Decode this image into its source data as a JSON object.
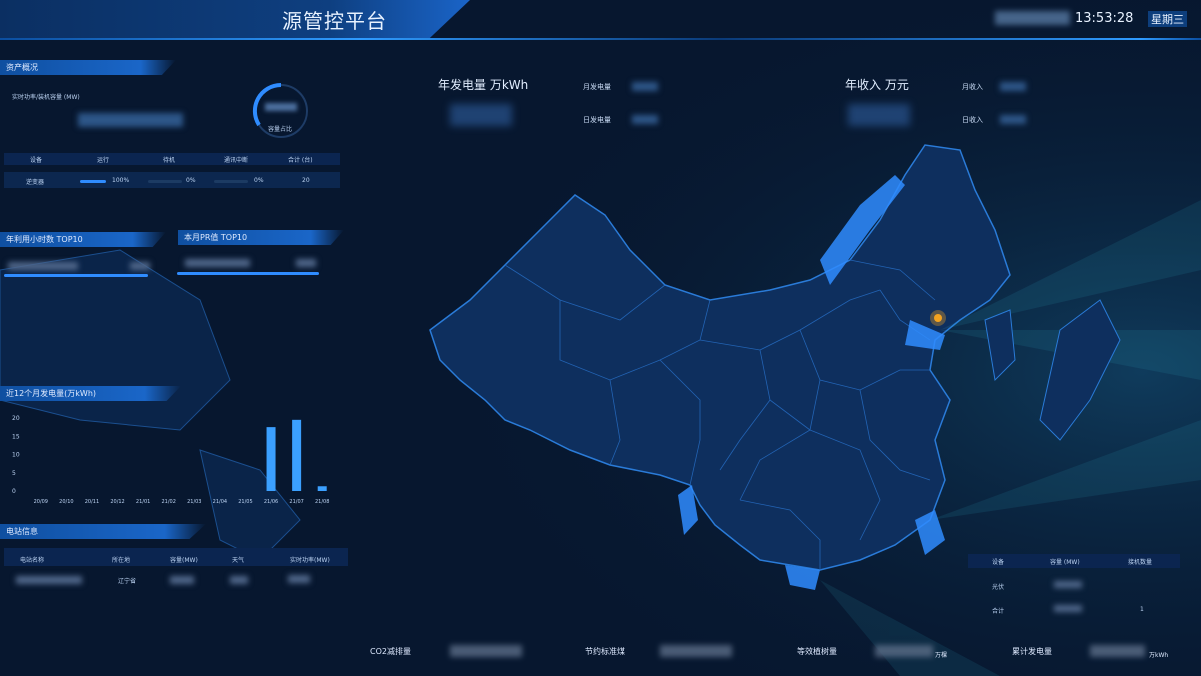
{
  "header": {
    "title": "源管控平台",
    "time": "13:53:28",
    "weekday": "星期三"
  },
  "asset_overview": {
    "tab": "资产概况",
    "capacity_label": "实时功率/装机容量 (MW)",
    "gauge_label": "容量占比",
    "table": {
      "headers": [
        "设备",
        "运行",
        "待机",
        "通讯中断",
        "合计 (台)"
      ],
      "row": {
        "name": "逆变器",
        "run": "100%",
        "standby": "0%",
        "comm_fail": "0%",
        "total": "20"
      },
      "run_fraction": 1.0,
      "standby_fraction": 0.0,
      "comm_fraction": 0.0
    }
  },
  "ranking": {
    "tab_left": "年利用小时数 TOP10",
    "tab_right": "本月PR值 TOP10",
    "left_fraction": 1.0,
    "right_fraction": 1.0
  },
  "monthly_chart": {
    "tab": "近12个月发电量(万kWh)"
  },
  "chart_data": {
    "type": "bar",
    "categories": [
      "20/09",
      "20/10",
      "20/11",
      "20/12",
      "21/01",
      "21/02",
      "21/03",
      "21/04",
      "21/05",
      "21/06",
      "21/07",
      "21/08"
    ],
    "values": [
      0,
      0,
      0,
      0,
      0,
      0,
      0,
      0,
      0,
      17.5,
      19.5,
      1.3
    ],
    "ylim": [
      0,
      20
    ],
    "yticks": [
      0,
      5,
      10,
      15,
      20
    ],
    "color": "#3ba0ff"
  },
  "site_info": {
    "tab": "电站信息",
    "headers": [
      "电站名称",
      "所在地",
      "容量(MW)",
      "天气",
      "实时功率(MW)"
    ],
    "location": "辽宁省"
  },
  "top_stats": {
    "annual_gen_label": "年发电量 万kWh",
    "annual_income_label": "年收入 万元",
    "monthly_gen_label": "月发电量",
    "daily_gen_label": "日发电量",
    "monthly_income_label": "月收入",
    "daily_income_label": "日收入"
  },
  "device_table": {
    "headers": [
      "设备",
      "容量 (MW)",
      "接机数量"
    ],
    "rows": [
      {
        "name": "光伏",
        "count": ""
      },
      {
        "name": "合计",
        "count": "1"
      }
    ]
  },
  "footer": {
    "co2_label": "CO2减排量",
    "coal_label": "节约标准煤",
    "tree_label": "等效植树量",
    "tree_unit": "万棵",
    "total_label": "累计发电量",
    "total_unit": "万kWh"
  },
  "colors": {
    "background": "#07172f",
    "accent": "#2f8cff",
    "map_fill": "#0e2f5e",
    "map_border": "#2a7bd8",
    "marker": "#f3a320"
  }
}
